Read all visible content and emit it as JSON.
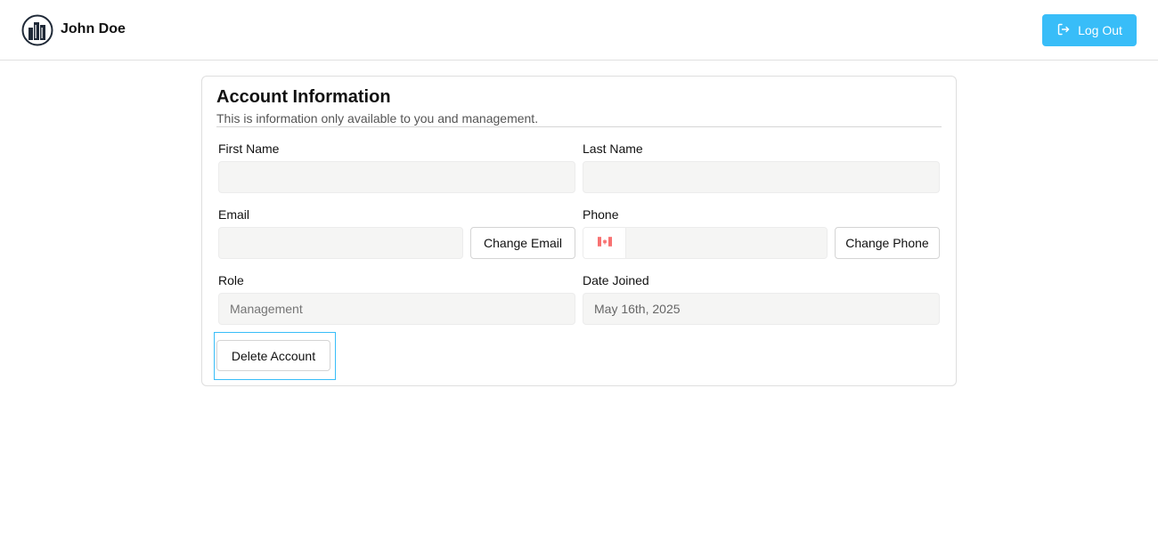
{
  "header": {
    "username": "John Doe",
    "logout_label": "Log Out"
  },
  "account": {
    "title": "Account Information",
    "subtitle": "This is information only available to you and management.",
    "first_name": {
      "label": "First Name",
      "value": ""
    },
    "last_name": {
      "label": "Last Name",
      "value": ""
    },
    "email": {
      "label": "Email",
      "value": "",
      "change_label": "Change Email"
    },
    "phone": {
      "label": "Phone",
      "value": "",
      "country": "CA",
      "change_label": "Change Phone"
    },
    "role": {
      "label": "Role",
      "placeholder": "Management"
    },
    "date_joined": {
      "label": "Date Joined",
      "value": "May 16th, 2025"
    },
    "delete_label": "Delete Account"
  },
  "colors": {
    "accent": "#38bdf8",
    "input_bg": "#f5f5f4",
    "flag_red": "#f87171"
  },
  "icons": {
    "logo": "city-buildings-icon",
    "logout": "logout-icon",
    "flag": "canada-flag-icon"
  }
}
